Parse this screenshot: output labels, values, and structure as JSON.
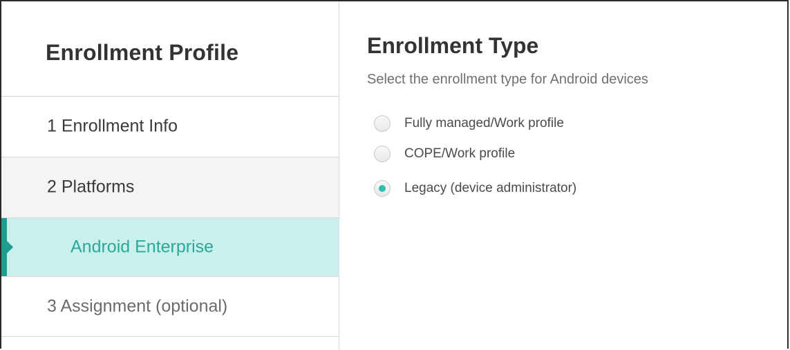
{
  "sidebar": {
    "title": "Enrollment Profile",
    "items": [
      {
        "label": "1  Enrollment Info"
      },
      {
        "label": "2  Platforms"
      },
      {
        "label": "Android Enterprise"
      },
      {
        "label": "3  Assignment (optional)"
      }
    ]
  },
  "main": {
    "title": "Enrollment Type",
    "subtitle": "Select the enrollment type for Android devices",
    "options": [
      {
        "label": "Fully managed/Work profile",
        "selected": false
      },
      {
        "label": "COPE/Work profile",
        "selected": false
      },
      {
        "label": "Legacy (device administrator)",
        "selected": true
      }
    ]
  },
  "colors": {
    "accent": "#2fbfae",
    "active_background": "#c9f0ec",
    "active_text": "#2aa899",
    "active_marker": "#1e9e8f"
  }
}
